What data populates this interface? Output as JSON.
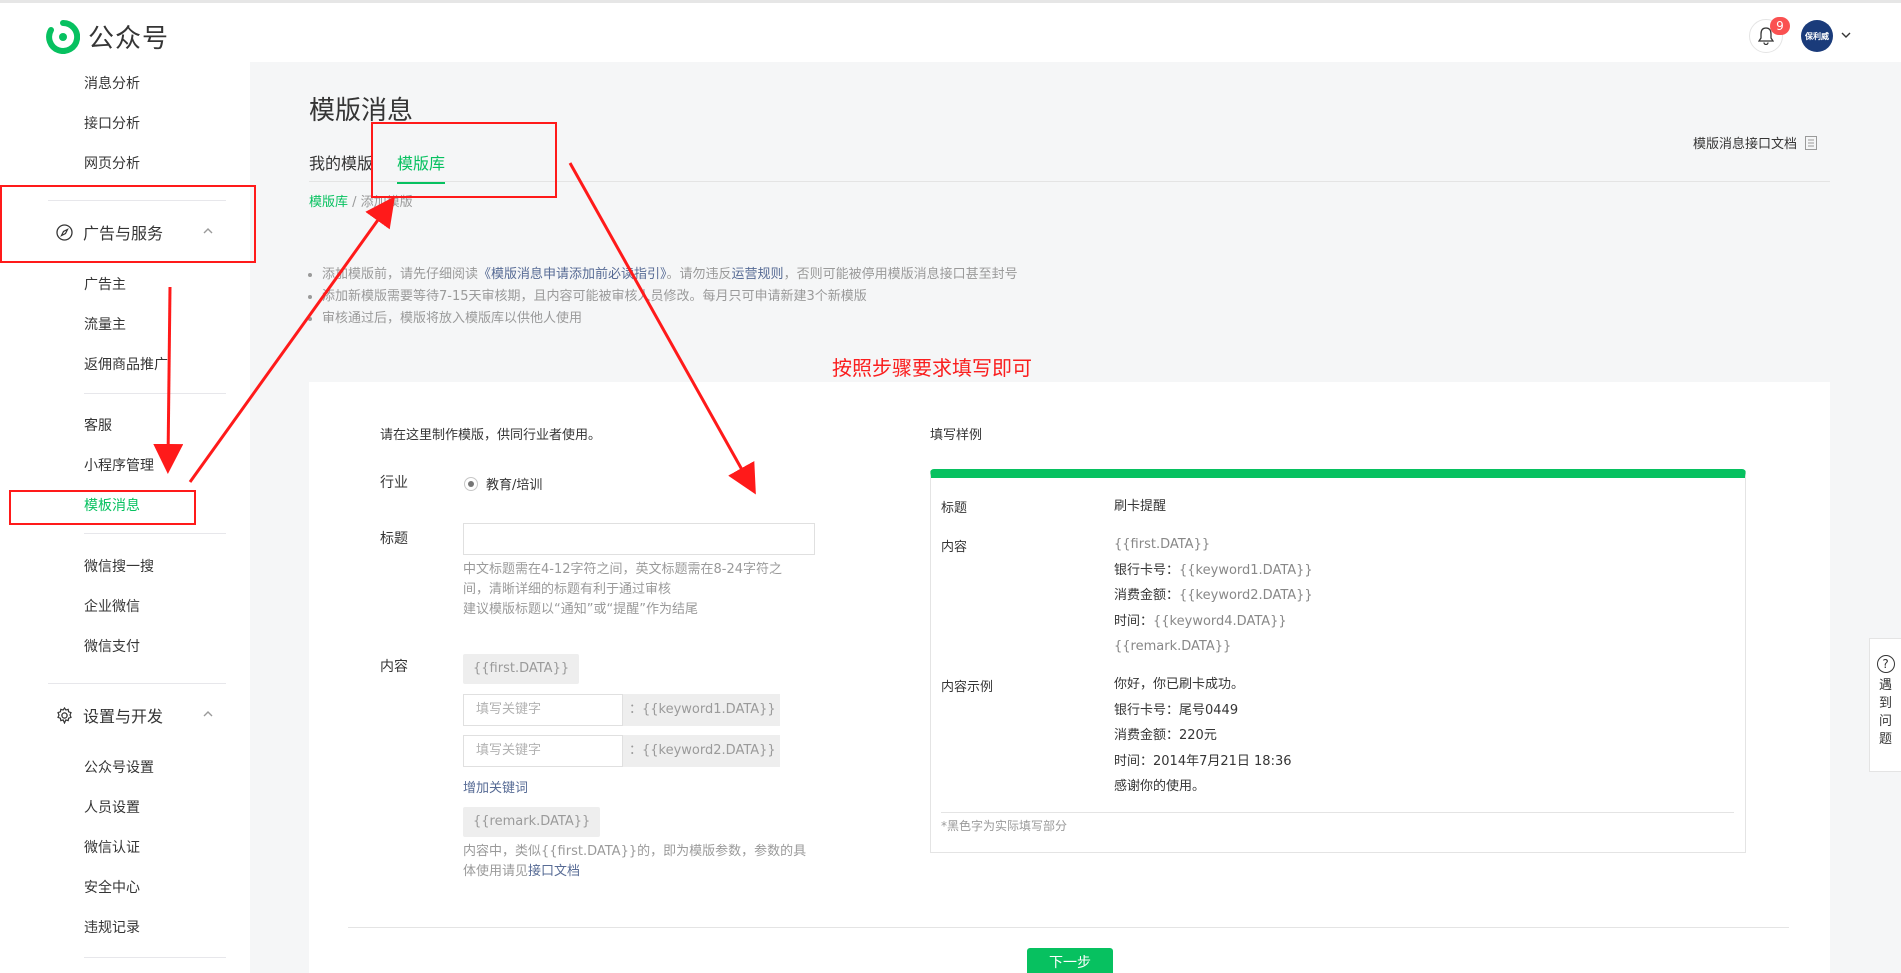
{
  "app": {
    "title": "公众号",
    "notification_count": "9",
    "avatar_text": "保利威"
  },
  "sidebar": {
    "items_top": [
      "消息分析",
      "接口分析",
      "网页分析"
    ],
    "group_ads": "广告与服务",
    "ads_items": [
      "广告主",
      "流量主",
      "返佣商品推广"
    ],
    "service_items": [
      "客服",
      "小程序管理",
      "模板消息"
    ],
    "search_items": [
      "微信搜一搜",
      "企业微信",
      "微信支付"
    ],
    "group_settings": "设置与开发",
    "settings_items": [
      "公众号设置",
      "人员设置",
      "微信认证",
      "安全中心",
      "违规记录"
    ]
  },
  "page": {
    "title": "模版消息",
    "tabs": [
      "我的模版",
      "模版库"
    ],
    "doc_link": "模版消息接口文档",
    "breadcrumb": {
      "root": "模版库",
      "sep": " / ",
      "current": "添加模版"
    },
    "notes": {
      "n1_a": "添加模版前，请先仔细阅读",
      "n1_link1": "《模版消息申请添加前必读指引》",
      "n1_b": "。请勿违反",
      "n1_link2": "运营规则",
      "n1_c": "，否则可能被停用模版消息接口甚至封号",
      "n2": "添加新模版需要等待7-15天审核期，且内容可能被审核人员修改。每月只可申请新建3个新模版",
      "n3": "审核通过后，模版将放入模版库以供他人使用"
    },
    "annotation_text": "按照步骤要求填写即可"
  },
  "form": {
    "intro": "请在这里制作模版，供同行业者使用。",
    "industry_label": "行业",
    "industry_value": "教育/培训",
    "title_label": "标题",
    "title_value": "",
    "title_help_1": "中文标题需在4-12字符之间，英文标题需在8-24字符之",
    "title_help_2": "间，清晰详细的标题有利于通过审核",
    "title_help_3": "建议模版标题以“通知”或“提醒”作为结尾",
    "content_label": "内容",
    "first_tag": "{{first.DATA}}",
    "keyword_placeholder": "填写关键字",
    "keyword1": "：{{keyword1.DATA}}",
    "keyword2": "：{{keyword2.DATA}}",
    "add_keyword": "增加关键词",
    "remark_tag": "{{remark.DATA}}",
    "content_help_1": "内容中，类似{{first.DATA}}的，即为模版参数，参数的具",
    "content_help_2": "体使用请见",
    "content_help_link": "接口文档",
    "next_button": "下一步"
  },
  "sample": {
    "header": "填写样例",
    "title_label": "标题",
    "title_value": "刷卡提醒",
    "content_label": "内容",
    "content_lines": [
      {
        "k": "",
        "v": "{{first.DATA}}"
      },
      {
        "k": "银行卡号：",
        "v": "{{keyword1.DATA}}"
      },
      {
        "k": "消费金额：",
        "v": "{{keyword2.DATA}}"
      },
      {
        "k": "时间：",
        "v": "{{keyword4.DATA}}"
      },
      {
        "k": "",
        "v": "{{remark.DATA}}"
      }
    ],
    "example_label": "内容示例",
    "example_lines": [
      "你好，你已刷卡成功。",
      "银行卡号：尾号0449",
      "消费金额：220元",
      "时间：2014年7月21日 18:36",
      "感谢你的使用。"
    ],
    "footnote": "*黑色字为实际填写部分"
  },
  "help_float": {
    "icon": "?",
    "text": [
      "遇",
      "到",
      "问",
      "题"
    ]
  },
  "colors": {
    "brand": "#07c160",
    "annotation": "#ff1a1a",
    "link": "#576b95"
  }
}
